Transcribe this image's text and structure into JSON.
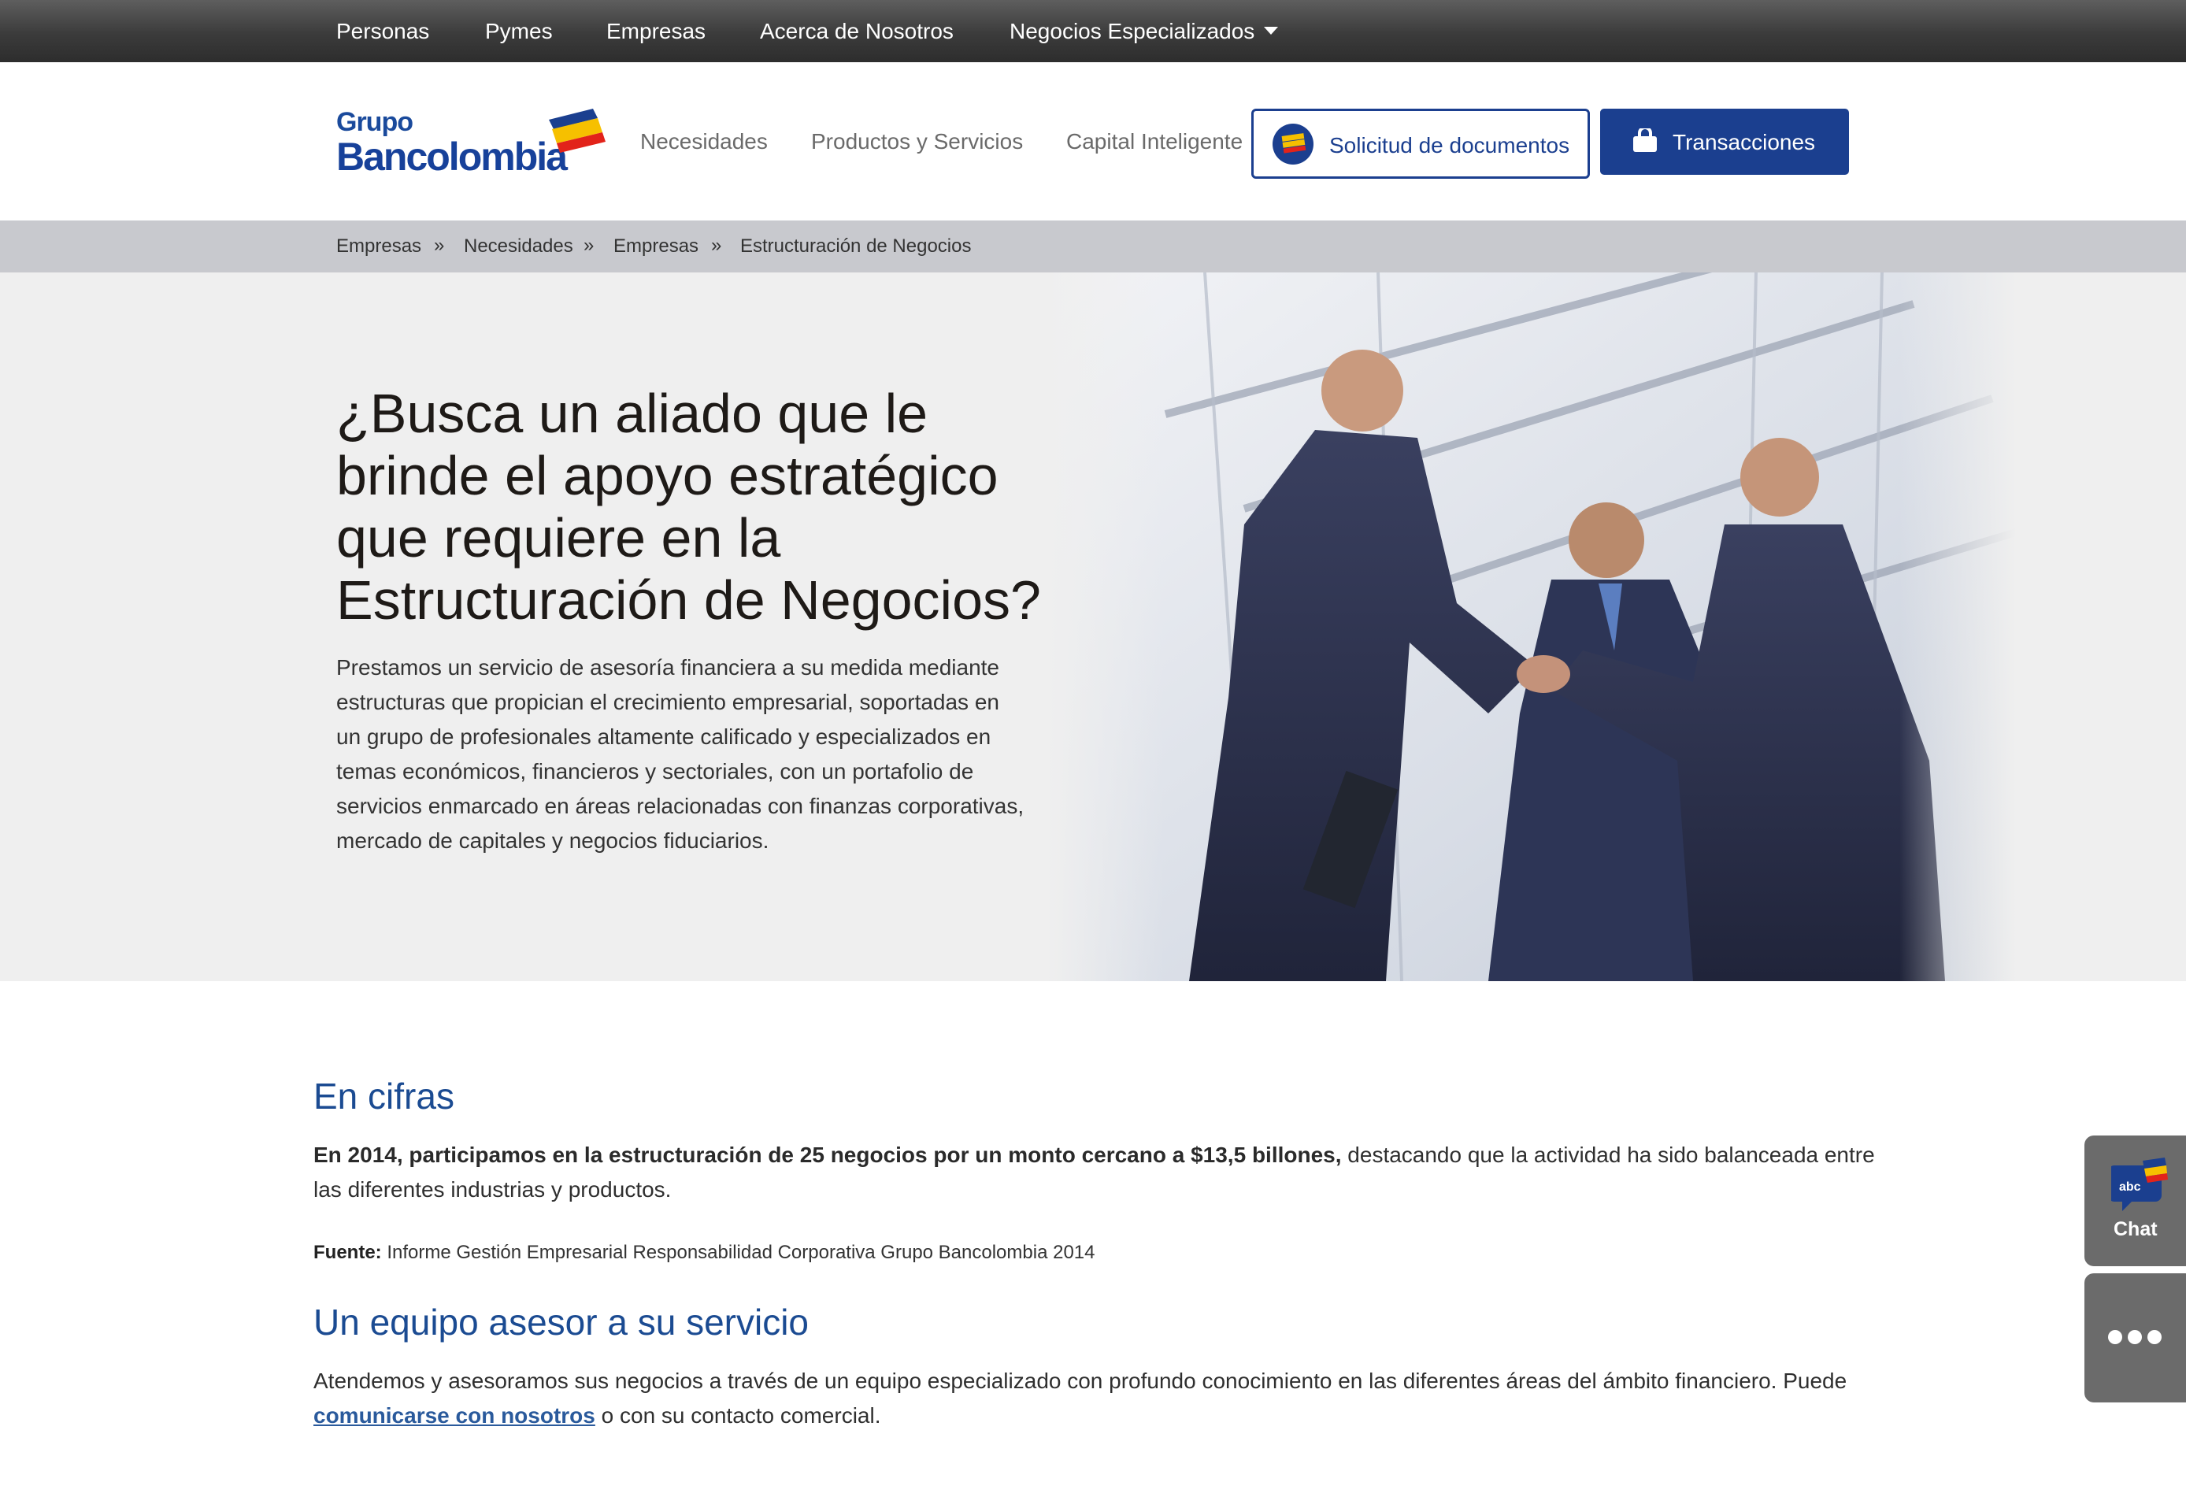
{
  "top_nav": {
    "items": [
      "Personas",
      "Pymes",
      "Empresas",
      "Acerca de Nosotros",
      "Negocios Especializados"
    ]
  },
  "logo": {
    "line1": "Grupo",
    "line2": "Bancolombia"
  },
  "main_nav": {
    "items": [
      "Necesidades",
      "Productos y Servicios",
      "Capital Inteligente"
    ]
  },
  "buttons": {
    "docs_label": "Solicitud de documentos",
    "transactions_label": "Transacciones"
  },
  "breadcrumb": {
    "items": [
      "Empresas",
      "Necesidades",
      "Empresas",
      "Estructuración de Negocios"
    ],
    "separator": "»"
  },
  "hero": {
    "title": "¿Busca un aliado que le brinde el apoyo estratégico que requiere en la Estructuración de Negocios?",
    "text": "Prestamos un servicio de asesoría financiera a su medida mediante estructuras que propician el crecimiento empresarial, soportadas en un grupo de profesionales altamente calificado y especializados en temas económicos, financieros y sectoriales, con un portafolio de servicios enmarcado en áreas relacionadas con finanzas corporativas, mercado de capitales y negocios fiduciarios."
  },
  "cifras": {
    "heading": "En cifras",
    "bold_text": "En 2014, participamos en la estructuración de 25 negocios por un monto cercano a $13,5 billones,",
    "rest_text": " destacando que la actividad ha sido balanceada entre las diferentes industrias y productos.",
    "source_label": "Fuente:",
    "source_text": " Informe Gestión Empresarial Responsabilidad Corporativa Grupo Bancolombia 2014"
  },
  "equipo": {
    "heading": "Un equipo asesor a su servicio",
    "text_before": "Atendemos y asesoramos sus negocios a través de un equipo especializado con profundo conocimiento en las diferentes áreas del ámbito financiero. Puede ",
    "link_text": "comunicarse con nosotros",
    "text_after": " o con su contacto comercial."
  },
  "side": {
    "chat_badge": "abc",
    "chat_label": "Chat"
  },
  "colors": {
    "topbar": "#3b3b3b",
    "brand_blue": "#1b3f8f",
    "heading_blue": "#1b4b92",
    "breadcrumb_bg": "#c8c9ce",
    "hero_bg": "#efefef",
    "side_widget": "#6b6b6b",
    "logo_yellow": "#f6c000",
    "logo_red": "#e2231a"
  }
}
